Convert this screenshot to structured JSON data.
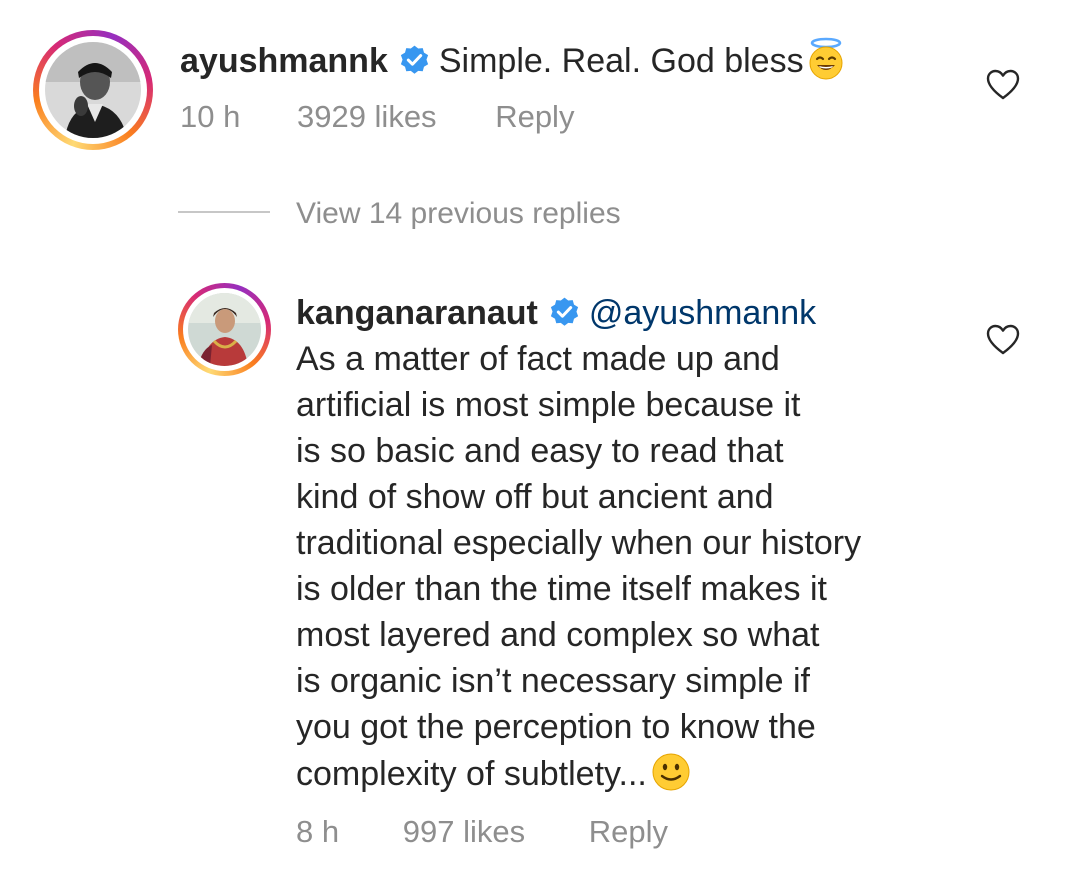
{
  "comment": {
    "username": "ayushmannk",
    "text": "Simple. Real. God bless",
    "text_emoji": "smiling-face-with-halo",
    "time": "10 h",
    "likes": "3929 likes",
    "reply_label": "Reply"
  },
  "view_replies": "View 14 previous replies",
  "reply": {
    "username": "kanganaranaut",
    "mention": "@ayushmannk",
    "lines": [
      "As a matter of fact made up and",
      "artificial is most simple because it",
      "is so basic and easy to read that",
      "kind of show off but ancient and",
      "traditional especially when our history",
      "is older than the time itself makes it",
      "most layered and complex so what",
      "is organic isn’t necessary simple if",
      "you got the perception to know the",
      "complexity of subtlety..."
    ],
    "text_emoji": "slightly-smiling-face",
    "time": "8 h",
    "likes": "997 likes",
    "reply_label": "Reply"
  },
  "colors": {
    "text": "#262626",
    "meta": "#8e8e8e",
    "verified_blue": "#3897f0",
    "mention": "#00376b"
  }
}
